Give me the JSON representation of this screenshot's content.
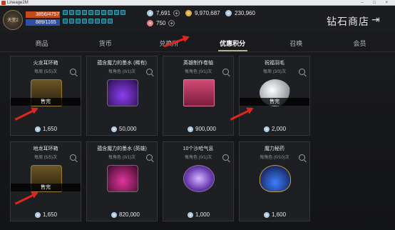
{
  "window": {
    "title": "Lineage2M",
    "controls": "– □ ×"
  },
  "player": {
    "hp": "3856/4757",
    "mp": "889/1165",
    "avatar_label": "天堂2"
  },
  "currencies": [
    {
      "icon": "diamond-icon",
      "value": "7,691"
    },
    {
      "icon": "gold-icon",
      "value": "9,970,687"
    },
    {
      "icon": "crystal-icon",
      "value": "230,960"
    },
    {
      "icon": "red-diamond-icon",
      "value": "750"
    }
  ],
  "shop": {
    "title": "钻石商店",
    "exit": "⇥"
  },
  "tabs": [
    "商品",
    "货币",
    "兑换所",
    "优惠积分",
    "召唤",
    "会员"
  ],
  "active_tab": 3,
  "items": [
    {
      "name": "火龙耳环箱",
      "limit": "每周 (5/5)次",
      "price": "1,650",
      "sold_out": "售完",
      "art": "chest"
    },
    {
      "name": "蕴含魔力的墨水 (稀有)",
      "limit": "每角色 (0/1)次",
      "price": "50,000",
      "sold_out": "",
      "art": "ink-purple"
    },
    {
      "name": "英雄制作卷轴",
      "limit": "每角色 (0/1)次",
      "price": "900,000",
      "sold_out": "",
      "art": "scroll"
    },
    {
      "name": "祝福羽毛",
      "limit": "每周 (3/3)次",
      "price": "2,000",
      "sold_out": "售完",
      "art": "feather"
    },
    {
      "name": "地龙耳环箱",
      "limit": "每周 (5/5)次",
      "price": "1,650",
      "sold_out": "售完",
      "art": "chest"
    },
    {
      "name": "蕴含魔力的墨水 (英雄)",
      "limit": "每角色 (0/1)次",
      "price": "820,000",
      "sold_out": "",
      "art": "ink-pink"
    },
    {
      "name": "10个沙哈气息",
      "limit": "每角色 (0/1)次",
      "price": "1,000",
      "sold_out": "",
      "art": "gem-purple"
    },
    {
      "name": "魔力秘药",
      "limit": "每角色 (0/10)次",
      "price": "1,600",
      "sold_out": "",
      "art": "potion"
    }
  ],
  "colors": {
    "accent_underline": "#b7b08a",
    "annotation_arrow": "#e0261c",
    "card_bg": "#1d1f23"
  }
}
